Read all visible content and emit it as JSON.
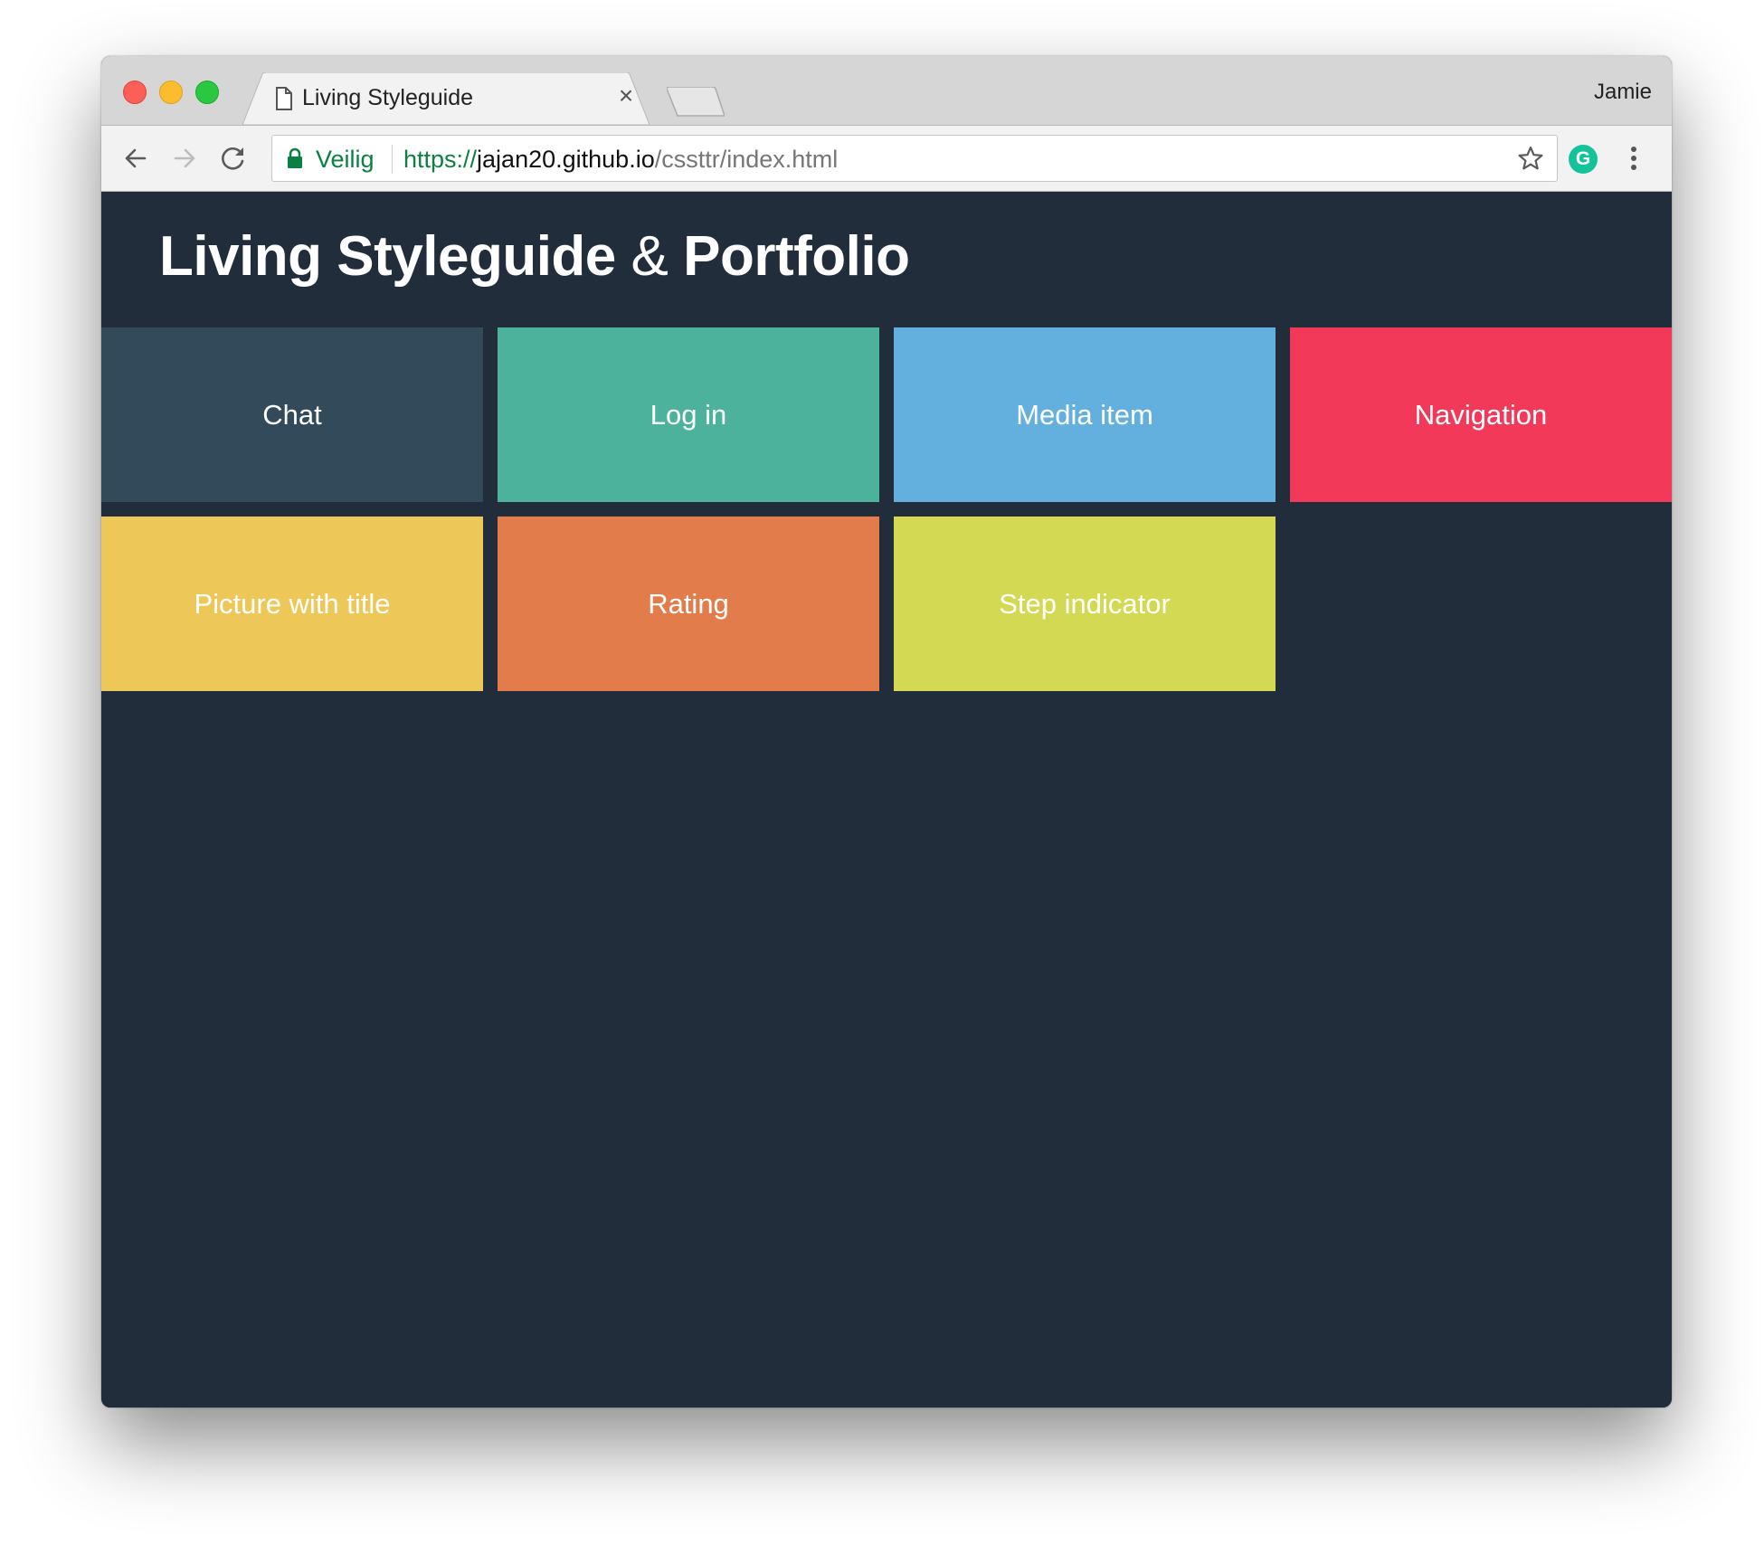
{
  "browser": {
    "tab_title": "Living Styleguide",
    "tab_close": "×",
    "profile_name": "Jamie",
    "secure_label": "Veilig",
    "url": {
      "scheme": "https://",
      "host": "jajan20.github.io",
      "path": "/cssttr/index.html"
    },
    "extension_letter": "G"
  },
  "page": {
    "title_part1": "Living Styleguide",
    "title_amp": "&",
    "title_part2": "Portfolio"
  },
  "tiles": [
    {
      "label": "Chat",
      "color": "#324a5a"
    },
    {
      "label": "Log in",
      "color": "#4db29b"
    },
    {
      "label": "Media item",
      "color": "#63b0df"
    },
    {
      "label": "Navigation",
      "color": "#f2395a"
    },
    {
      "label": "Picture with title",
      "color": "#edc858"
    },
    {
      "label": "Rating",
      "color": "#e27c4a"
    },
    {
      "label": "Step indicator",
      "color": "#d3d952"
    }
  ],
  "colors": {
    "page_background": "#212d3b",
    "secure_green": "#0b8043"
  }
}
